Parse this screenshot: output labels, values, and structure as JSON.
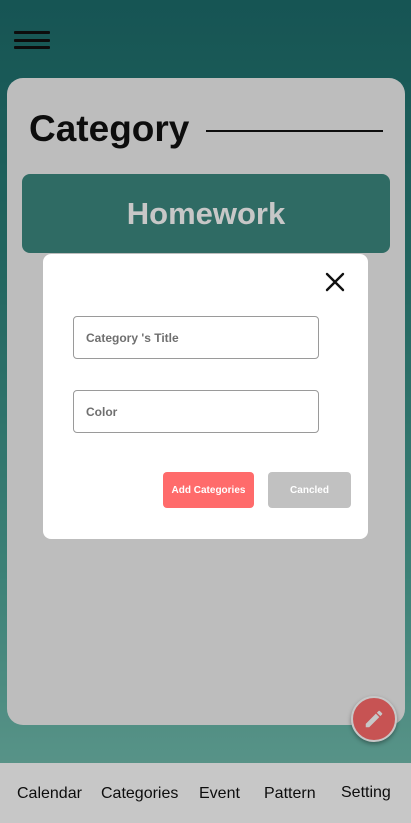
{
  "header": {
    "menu_icon": "hamburger-icon"
  },
  "page": {
    "title": "Category"
  },
  "categories": [
    {
      "label": "Homework",
      "color": "#3d8a80"
    }
  ],
  "dialog": {
    "title_field": {
      "placeholder": "Category 's Title",
      "value": ""
    },
    "color_field": {
      "placeholder": "Color",
      "value": ""
    },
    "add_label": "Add Categories",
    "cancel_label": "Cancled",
    "close_icon": "close-icon"
  },
  "fab": {
    "icon": "pencil-icon",
    "color": "#ff6b6b"
  },
  "nav": {
    "items": [
      {
        "label": "Calendar"
      },
      {
        "label": "Categories"
      },
      {
        "label": "Event"
      },
      {
        "label": "Pattern"
      },
      {
        "label": "Setting"
      }
    ]
  },
  "colors": {
    "accent": "#ff6b6b",
    "teal_dark": "#1d6d6c",
    "cancel_gray": "#c1c1c1"
  }
}
